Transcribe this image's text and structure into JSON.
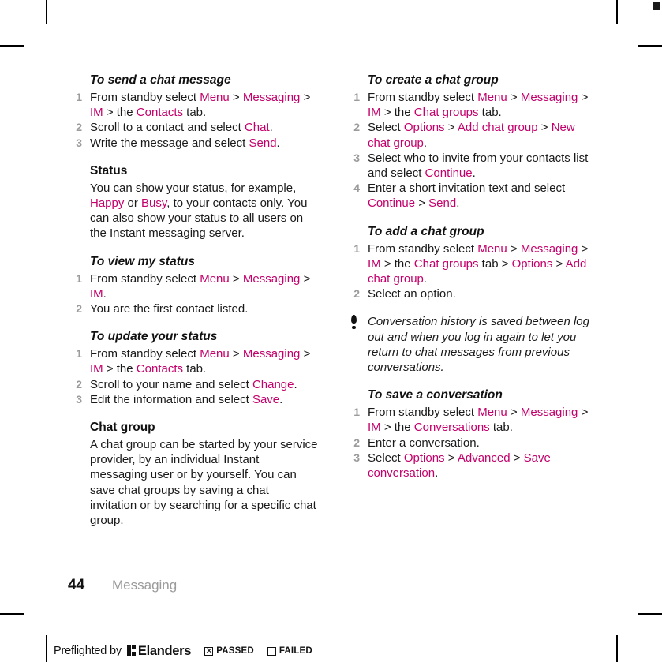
{
  "theme": {
    "highlight_color": "#c4006b",
    "text_color": "#1a1a1a",
    "step_number_color": "#9b9b9b",
    "chapter_color": "#9b9b9b"
  },
  "left_column": {
    "section_1": {
      "heading": "To send a chat message",
      "steps": [
        {
          "num": "1",
          "text_1": "From standby select ",
          "hl_1": "Menu",
          "text_2": " > ",
          "hl_2": "Messaging",
          "text_3": " > ",
          "hl_3": "IM",
          "text_4": " > the ",
          "hl_4": "Contacts",
          "text_5": " tab."
        },
        {
          "num": "2",
          "text_1": "Scroll to a contact and select ",
          "hl_1": "Chat",
          "text_2": "."
        },
        {
          "num": "3",
          "text_1": "Write the message and select ",
          "hl_1": "Send",
          "text_2": "."
        }
      ]
    },
    "section_2": {
      "heading": "Status",
      "paragraph_1": "You can show your status, for example, ",
      "hl_1": "Happy",
      "paragraph_2": " or ",
      "hl_2": "Busy",
      "paragraph_3": ", to your contacts only. You can also show your status to all users on the Instant messaging server."
    },
    "section_3": {
      "heading": "To view my status",
      "steps": [
        {
          "num": "1",
          "text_1": "From standby select ",
          "hl_1": "Menu",
          "text_2": " > ",
          "hl_2": "Messaging",
          "text_3": " > ",
          "hl_3": "IM",
          "text_4": "."
        },
        {
          "num": "2",
          "text_1": "You are the first contact listed."
        }
      ]
    },
    "section_4": {
      "heading": "To update your status",
      "steps": [
        {
          "num": "1",
          "text_1": "From standby select ",
          "hl_1": "Menu",
          "text_2": " > ",
          "hl_2": "Messaging",
          "text_3": " > ",
          "hl_3": "IM",
          "text_4": " > the ",
          "hl_4": "Contacts",
          "text_5": " tab."
        },
        {
          "num": "2",
          "text_1": "Scroll to your name and select ",
          "hl_1": "Change",
          "text_2": "."
        },
        {
          "num": "3",
          "text_1": "Edit the information and select ",
          "hl_1": "Save",
          "text_2": "."
        }
      ]
    },
    "section_5": {
      "heading": "Chat group",
      "paragraph": "A chat group can be started by your service provider, by an individual Instant messaging user or by yourself. You can save chat groups by saving a chat invitation or by searching for a specific chat group."
    }
  },
  "right_column": {
    "section_1": {
      "heading": "To create a chat group",
      "steps": [
        {
          "num": "1",
          "text_1": "From standby select ",
          "hl_1": "Menu",
          "text_2": " > ",
          "hl_2": "Messaging",
          "text_3": " > ",
          "hl_3": "IM",
          "text_4": " > the ",
          "hl_4": "Chat groups",
          "text_5": " tab."
        },
        {
          "num": "2",
          "text_1": "Select ",
          "hl_1": "Options",
          "text_2": " > ",
          "hl_2": "Add chat group",
          "text_3": " > ",
          "hl_3": "New chat group",
          "text_4": "."
        },
        {
          "num": "3",
          "text_1": "Select who to invite from your contacts list and select ",
          "hl_1": "Continue",
          "text_2": "."
        },
        {
          "num": "4",
          "text_1": "Enter a short invitation text and select ",
          "hl_1": "Continue",
          "text_2": " > ",
          "hl_2": "Send",
          "text_3": "."
        }
      ]
    },
    "section_2": {
      "heading": "To add a chat group",
      "steps": [
        {
          "num": "1",
          "text_1": "From standby select ",
          "hl_1": "Menu",
          "text_2": " > ",
          "hl_2": "Messaging",
          "text_3": " > ",
          "hl_3": "IM",
          "text_4": " > the ",
          "hl_4": "Chat groups",
          "text_5": " tab > ",
          "hl_5": "Options",
          "text_6": " > ",
          "hl_6": "Add chat group",
          "text_7": "."
        },
        {
          "num": "2",
          "text_1": "Select an option."
        }
      ]
    },
    "tip": {
      "icon": "exclamation-tip-icon",
      "text": "Conversation history is saved between log out and when you log in again to let you return to chat messages from previous conversations."
    },
    "section_3": {
      "heading": "To save a conversation",
      "steps": [
        {
          "num": "1",
          "text_1": "From standby select ",
          "hl_1": "Menu",
          "text_2": " > ",
          "hl_2": "Messaging",
          "text_3": " > ",
          "hl_3": "IM",
          "text_4": " > the ",
          "hl_4": "Conversations",
          "text_5": " tab."
        },
        {
          "num": "2",
          "text_1": "Enter a conversation."
        },
        {
          "num": "3",
          "text_1": "Select ",
          "hl_1": "Options",
          "text_2": " > ",
          "hl_2": "Advanced",
          "text_3": " > ",
          "hl_3": "Save conversation",
          "text_4": "."
        }
      ]
    }
  },
  "footer": {
    "page_number": "44",
    "chapter": "Messaging"
  },
  "preflight": {
    "label": "Preflighted by",
    "brand": "Elanders",
    "passed_label": "PASSED",
    "failed_label": "FAILED",
    "passed_checked": true,
    "failed_checked": false
  }
}
